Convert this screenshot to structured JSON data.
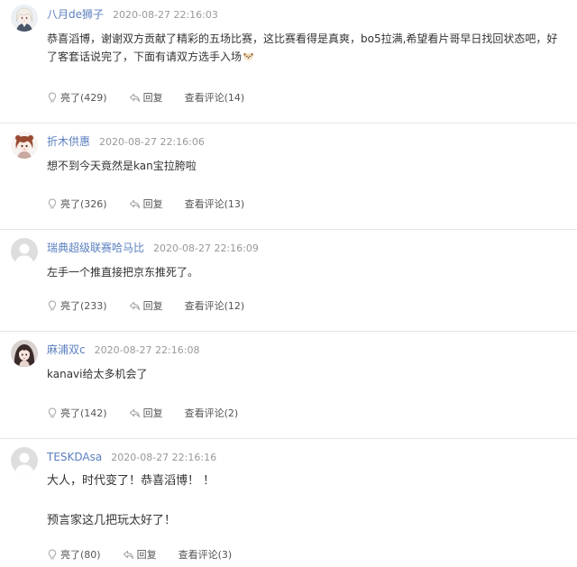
{
  "theme": {
    "username_color": "#5a7fbf",
    "time_color": "#999999",
    "text_color": "#333333",
    "action_color": "#555555",
    "icon_color": "#a3a3a3",
    "divider_color": "#e6e6e6"
  },
  "comments": [
    {
      "avatar_icon": "anime-girl-avatar",
      "username": "八月de狮子",
      "time": "2020-08-27 22:16:03",
      "paragraphs": [
        "恭喜滔博，谢谢双方贡献了精彩的五场比赛，这比赛看得是真爽，bo5拉满,希望看片哥早日找回状态吧，好了客套话说完了，下面有请双方选手入场"
      ],
      "trailing_emoji_icon": "dog-face-emoji",
      "actions": {
        "light": "亮了(429)",
        "reply": "回复",
        "view_comments": "查看评论(14)"
      }
    },
    {
      "avatar_icon": "red-hair-girl-avatar",
      "username": "折木供惠",
      "time": "2020-08-27 22:16:06",
      "paragraphs": [
        "想不到今天竟然是kan宝拉胯啦"
      ],
      "actions": {
        "light": "亮了(326)",
        "reply": "回复",
        "view_comments": "查看评论(13)"
      }
    },
    {
      "avatar_icon": "default-user-avatar",
      "username": "瑞典超级联赛哈马比",
      "time": "2020-08-27 22:16:09",
      "paragraphs": [
        "左手一个推直接把京东推死了。"
      ],
      "actions": {
        "light": "亮了(233)",
        "reply": "回复",
        "view_comments": "查看评论(12)"
      }
    },
    {
      "avatar_icon": "dark-hair-girl-avatar",
      "username": "麻浦双c",
      "time": "2020-08-27 22:16:08",
      "paragraphs": [
        "kanavi给太多机会了"
      ],
      "actions": {
        "light": "亮了(142)",
        "reply": "回复",
        "view_comments": "查看评论(2)"
      }
    },
    {
      "avatar_icon": "default-user-avatar",
      "username": "TESKDAsa",
      "time": "2020-08-27 22:16:16",
      "paragraphs": [
        "大人，时代变了！恭喜滔博！ ！",
        "预言家这几把玩太好了！"
      ],
      "actions": {
        "light": "亮了(80)",
        "reply": "回复",
        "view_comments": "查看评论(3)"
      }
    }
  ]
}
